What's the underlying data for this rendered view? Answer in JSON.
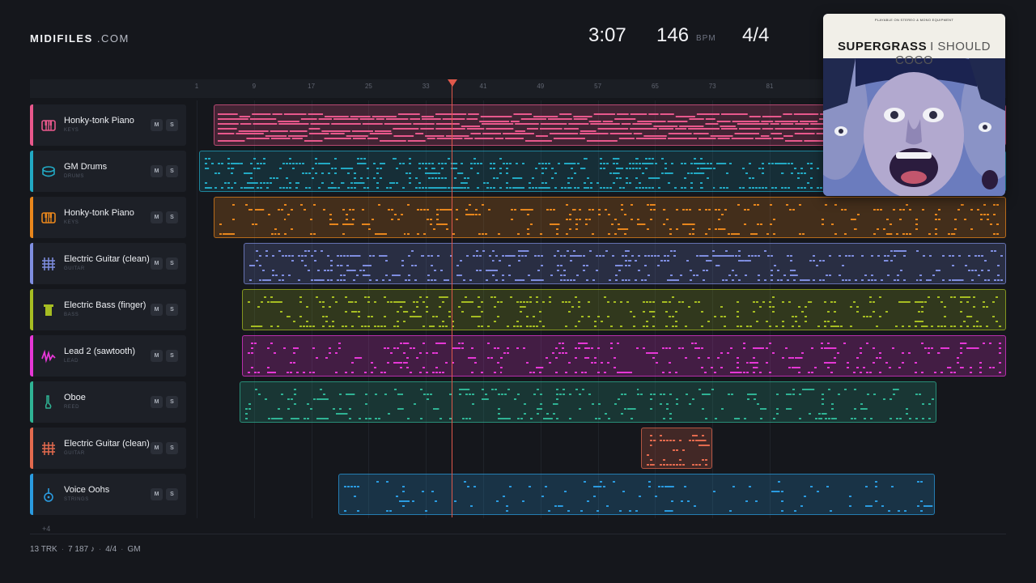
{
  "brand": {
    "name_bold": "MIDIFILES",
    "name_light": " .COM"
  },
  "header": {
    "time": "3:07",
    "bpm": "146",
    "bpm_unit": "BPM",
    "time_signature": "4/4"
  },
  "ruler": {
    "bars": [
      "1",
      "9",
      "17",
      "25",
      "33",
      "41",
      "49",
      "57",
      "65",
      "73",
      "81"
    ]
  },
  "playhead": {
    "position_bar": 33.6
  },
  "tracks": [
    {
      "name": "Honky-tonk Piano",
      "category": "KEYS",
      "icon": "piano-icon",
      "color": "#e8588c",
      "mute": "M",
      "solo": "S"
    },
    {
      "name": "GM Drums",
      "category": "DRUMS",
      "icon": "drum-icon",
      "color": "#22a9c4",
      "mute": "M",
      "solo": "S"
    },
    {
      "name": "Honky-tonk Piano",
      "category": "KEYS",
      "icon": "piano-icon",
      "color": "#e8861c",
      "mute": "M",
      "solo": "S"
    },
    {
      "name": "Electric Guitar (clean)",
      "category": "GUITAR",
      "icon": "guitar-grid-icon",
      "color": "#7f8ee0",
      "mute": "M",
      "solo": "S"
    },
    {
      "name": "Electric Bass (finger)",
      "category": "BASS",
      "icon": "bass-icon",
      "color": "#a6bd22",
      "mute": "M",
      "solo": "S"
    },
    {
      "name": "Lead 2 (sawtooth)",
      "category": "LEAD",
      "icon": "sawtooth-wave-icon",
      "color": "#e637d6",
      "mute": "M",
      "solo": "S"
    },
    {
      "name": "Oboe",
      "category": "REED",
      "icon": "oboe-icon",
      "color": "#2fb394",
      "mute": "M",
      "solo": "S"
    },
    {
      "name": "Electric Guitar (clean)",
      "category": "GUITAR",
      "icon": "guitar-grid-icon",
      "color": "#e36a4e",
      "mute": "M",
      "solo": "S"
    },
    {
      "name": "Voice Oohs",
      "category": "STRINGS",
      "icon": "voice-instrument-icon",
      "color": "#2a9be0",
      "mute": "M",
      "solo": "S"
    }
  ],
  "more_tracks": "+4",
  "footer": {
    "tracks": "13 TRK",
    "notes": "7 187 ♪",
    "signature": "4/4",
    "standard": "GM"
  },
  "cover": {
    "small_text": "PLAYABLE ON STEREO & MONO EQUIPMENT",
    "artist": "SUPERGRASS",
    "album": "I SHOULD COCO"
  }
}
